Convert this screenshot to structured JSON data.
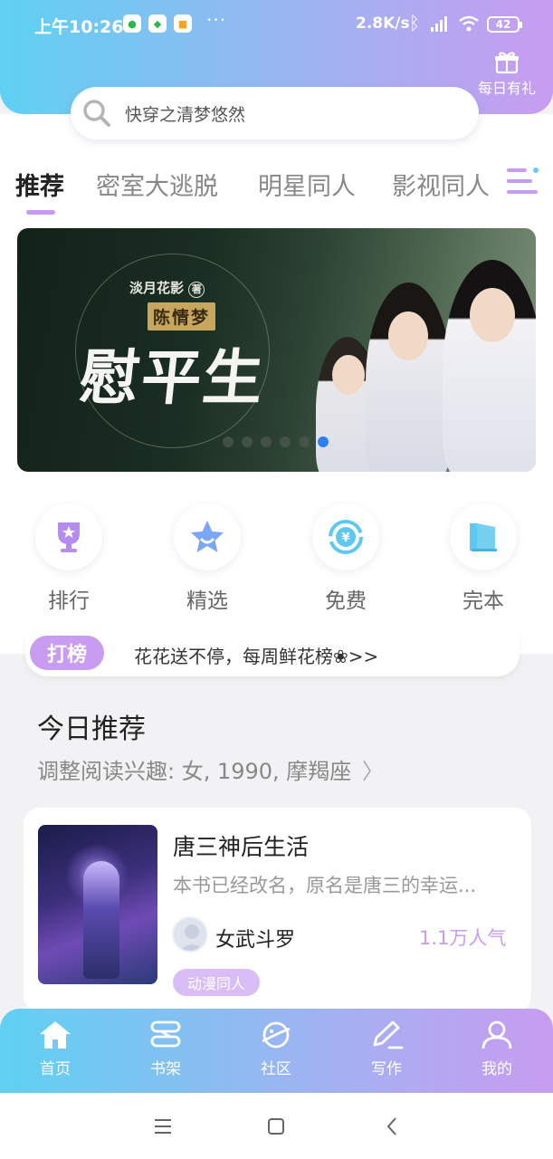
{
  "status_bar": {
    "time": "上午10:26",
    "more": "···",
    "speed": "2.8K/s",
    "battery": "42"
  },
  "header": {
    "gift_label": "每日有礼",
    "search_text": "快穿之清梦悠然"
  },
  "tabs": [
    {
      "label": "推荐"
    },
    {
      "label": "密室大逃脱"
    },
    {
      "label": "明星同人"
    },
    {
      "label": "影视同人"
    }
  ],
  "banner": {
    "author": "淡月花影",
    "author_mark": "著",
    "series": "陈情梦",
    "title": "慰平生",
    "dot_count": 6,
    "active_dot": 6
  },
  "quick_links": [
    {
      "label": "排行",
      "icon": "trophy-icon"
    },
    {
      "label": "精选",
      "icon": "star-icon"
    },
    {
      "label": "免费",
      "icon": "yuan-icon"
    },
    {
      "label": "完本",
      "icon": "book-icon"
    }
  ],
  "rank_strip": {
    "badge": "打榜",
    "text": "花花送不停，每周鲜花榜❀>>"
  },
  "today": {
    "title": "今日推荐",
    "subtitle": "调整阅读兴趣: 女, 1990, 摩羯座"
  },
  "book_card": {
    "title": "唐三神后生活",
    "description": "本书已经改名，原名是唐三的幸运...",
    "author": "女武斗罗",
    "popularity": "1.1万人气",
    "tag": "动漫同人"
  },
  "bottom_nav": [
    {
      "label": "首页",
      "icon": "home-icon"
    },
    {
      "label": "书架",
      "icon": "bookshelf-icon"
    },
    {
      "label": "社区",
      "icon": "planet-icon"
    },
    {
      "label": "写作",
      "icon": "pen-icon"
    },
    {
      "label": "我的",
      "icon": "user-icon"
    }
  ],
  "colors": {
    "accent": "#c89cf0",
    "gradient_start": "#5fd0f3",
    "gradient_end": "#c89cf0",
    "active_dot": "#2f7ff0"
  }
}
